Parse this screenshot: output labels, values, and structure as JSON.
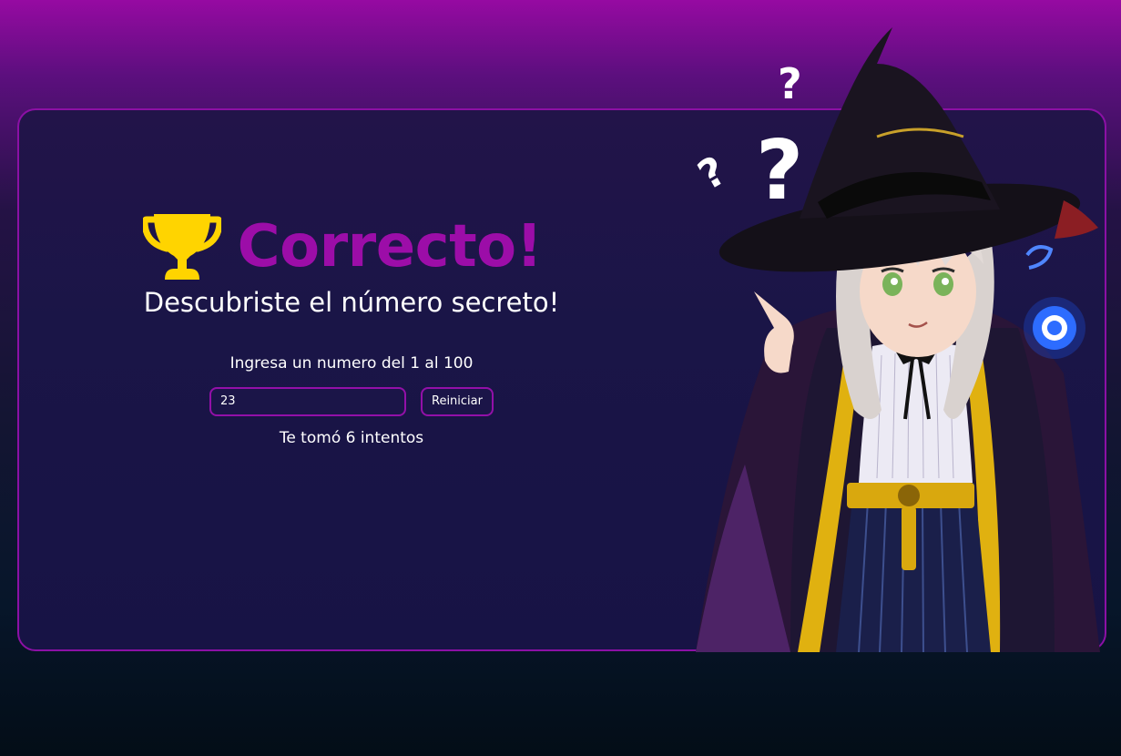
{
  "header": {
    "title": "Correcto!",
    "subtitle": "Descubriste el número secreto!"
  },
  "game": {
    "prompt": "Ingresa un numero del 1 al 100",
    "input_value": "23",
    "restart_label": "Reiniciar",
    "attempts_text": "Te tomó 6 intentos"
  },
  "icons": {
    "trophy": "trophy-icon",
    "illustration": "witch-illustration"
  },
  "colors": {
    "accent": "#9c0da8",
    "trophy": "#ffd400",
    "background_top": "#960aa2",
    "panel": "#1a1547"
  }
}
